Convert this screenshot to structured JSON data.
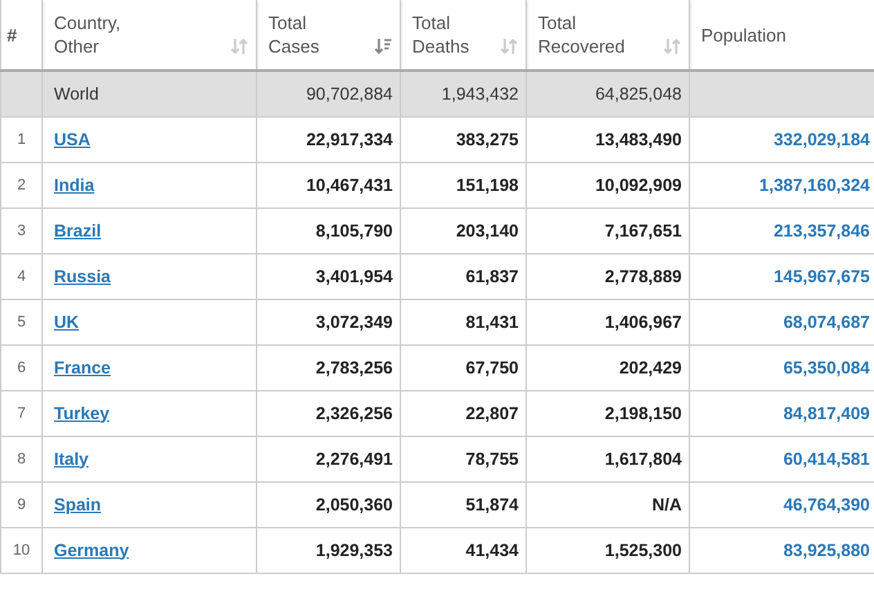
{
  "table": {
    "columns": [
      {
        "label": "#",
        "kind": "index"
      },
      {
        "label": "Country,\nOther",
        "kind": "sortable",
        "sorted": false
      },
      {
        "label": "Total\nCases",
        "kind": "sortable",
        "sorted": true
      },
      {
        "label": "Total\nDeaths",
        "kind": "sortable",
        "sorted": false
      },
      {
        "label": "Total\nRecovered",
        "kind": "sortable",
        "sorted": false
      },
      {
        "label": "Population",
        "kind": "plain"
      }
    ],
    "total_row": {
      "country": "World",
      "cases": "90,702,884",
      "deaths": "1,943,432",
      "recovered": "64,825,048"
    },
    "rows": [
      {
        "rank": "1",
        "country": "USA",
        "cases": "22,917,334",
        "deaths": "383,275",
        "recovered": "13,483,490",
        "population": "332,029,184"
      },
      {
        "rank": "2",
        "country": "India",
        "cases": "10,467,431",
        "deaths": "151,198",
        "recovered": "10,092,909",
        "population": "1,387,160,324"
      },
      {
        "rank": "3",
        "country": "Brazil",
        "cases": "8,105,790",
        "deaths": "203,140",
        "recovered": "7,167,651",
        "population": "213,357,846"
      },
      {
        "rank": "4",
        "country": "Russia",
        "cases": "3,401,954",
        "deaths": "61,837",
        "recovered": "2,778,889",
        "population": "145,967,675"
      },
      {
        "rank": "5",
        "country": "UK",
        "cases": "3,072,349",
        "deaths": "81,431",
        "recovered": "1,406,967",
        "population": "68,074,687"
      },
      {
        "rank": "6",
        "country": "France",
        "cases": "2,783,256",
        "deaths": "67,750",
        "recovered": "202,429",
        "population": "65,350,084"
      },
      {
        "rank": "7",
        "country": "Turkey",
        "cases": "2,326,256",
        "deaths": "22,807",
        "recovered": "2,198,150",
        "population": "84,817,409"
      },
      {
        "rank": "8",
        "country": "Italy",
        "cases": "2,276,491",
        "deaths": "78,755",
        "recovered": "1,617,804",
        "population": "60,414,581"
      },
      {
        "rank": "9",
        "country": "Spain",
        "cases": "2,050,360",
        "deaths": "51,874",
        "recovered": "N/A",
        "population": "46,764,390"
      },
      {
        "rank": "10",
        "country": "Germany",
        "cases": "1,929,353",
        "deaths": "41,434",
        "recovered": "1,525,300",
        "population": "83,925,880"
      }
    ]
  }
}
